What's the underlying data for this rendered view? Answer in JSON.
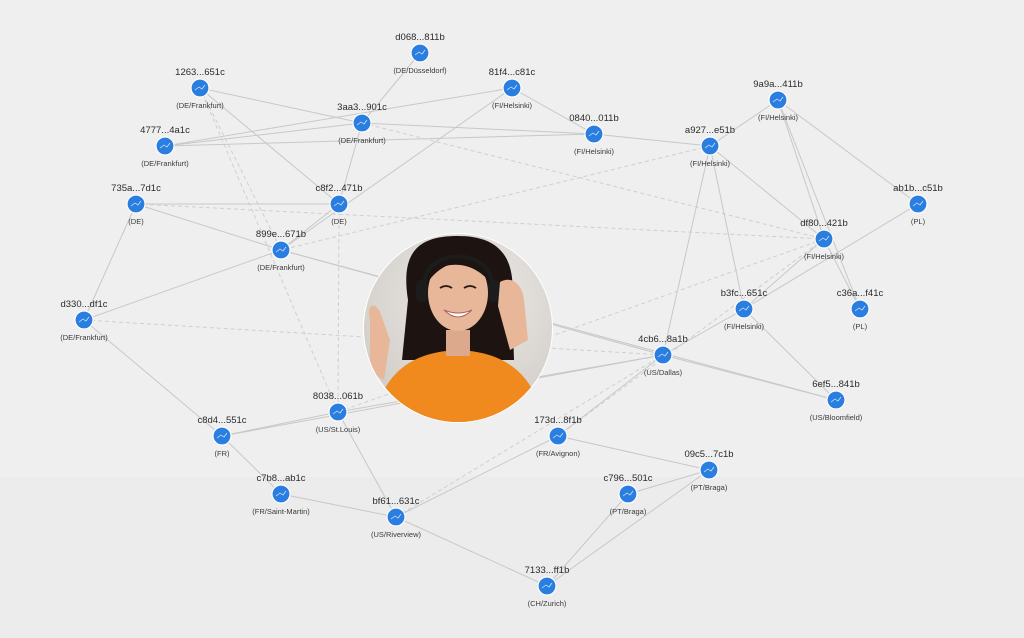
{
  "graph": {
    "nodes": [
      {
        "id": "n1",
        "label": "d068...811b",
        "location": "(DE/Düsseldorf)"
      },
      {
        "id": "n2",
        "label": "1263...651c",
        "location": "(DE/Frankfurt)"
      },
      {
        "id": "n3",
        "label": "81f4...c81c",
        "location": "(FI/Helsinki)"
      },
      {
        "id": "n4",
        "label": "3aa3...901c",
        "location": "(DE/Frankfurt)"
      },
      {
        "id": "n5",
        "label": "0840...011b",
        "location": "(FI/Helsinki)"
      },
      {
        "id": "n6",
        "label": "9a9a...411b",
        "location": "(FI/Helsinki)"
      },
      {
        "id": "n7",
        "label": "4777...4a1c",
        "location": "(DE/Frankfurt)"
      },
      {
        "id": "n8",
        "label": "a927...e51b",
        "location": "(FI/Helsinki)"
      },
      {
        "id": "n9",
        "label": "735a...7d1c",
        "location": "(DE)"
      },
      {
        "id": "n10",
        "label": "c8f2...471b",
        "location": "(DE)"
      },
      {
        "id": "n11",
        "label": "ab1b...c51b",
        "location": "(PL)"
      },
      {
        "id": "n12",
        "label": "899e...671b",
        "location": "(DE/Frankfurt)"
      },
      {
        "id": "n13",
        "label": "df80...421b",
        "location": "(FI/Helsinki)"
      },
      {
        "id": "n14",
        "label": "d330...df1c",
        "location": "(DE/Frankfurt)"
      },
      {
        "id": "n15",
        "label": "b3fc...651c",
        "location": "(FI/Helsinki)"
      },
      {
        "id": "n16",
        "label": "c36a...f41c",
        "location": "(PL)"
      },
      {
        "id": "n17",
        "label": "4cb6...8a1b",
        "location": "(US/Dallas)"
      },
      {
        "id": "n18",
        "label": "6ef5...841b",
        "location": "(US/Bloomfield)"
      },
      {
        "id": "n19",
        "label": "8038...061b",
        "location": "(US/St.Louis)"
      },
      {
        "id": "n20",
        "label": "c8d4...551c",
        "location": "(FR)"
      },
      {
        "id": "n21",
        "label": "173d...8f1b",
        "location": "(FR/Avignon)"
      },
      {
        "id": "n22",
        "label": "09c5...7c1b",
        "location": "(PT/Braga)"
      },
      {
        "id": "n23",
        "label": "c7b8...ab1c",
        "location": "(FR/Saint-Martin)"
      },
      {
        "id": "n24",
        "label": "c796...501c",
        "location": "(PT/Braga)"
      },
      {
        "id": "n25",
        "label": "bf61...631c",
        "location": "(US/Riverview)"
      },
      {
        "id": "n26",
        "label": "7133...ff1b",
        "location": "(CH/Zurich)"
      }
    ],
    "edges": [
      [
        "n2",
        "n4"
      ],
      [
        "n2",
        "n12",
        "dashed"
      ],
      [
        "n2",
        "n10"
      ],
      [
        "n7",
        "n4"
      ],
      [
        "n7",
        "n3"
      ],
      [
        "n7",
        "n5"
      ],
      [
        "n4",
        "n5"
      ],
      [
        "n4",
        "n10"
      ],
      [
        "n4",
        "n13",
        "dashed"
      ],
      [
        "n1",
        "n4"
      ],
      [
        "n3",
        "n5"
      ],
      [
        "n3",
        "n12"
      ],
      [
        "n5",
        "n8"
      ],
      [
        "n6",
        "n8"
      ],
      [
        "n6",
        "n13"
      ],
      [
        "n6",
        "n16"
      ],
      [
        "n6",
        "n11"
      ],
      [
        "n8",
        "n13"
      ],
      [
        "n8",
        "n15"
      ],
      [
        "n8",
        "n17"
      ],
      [
        "n8",
        "n12",
        "dashed"
      ],
      [
        "n9",
        "n10"
      ],
      [
        "n9",
        "n12"
      ],
      [
        "n9",
        "n14"
      ],
      [
        "n9",
        "n13",
        "dashed"
      ],
      [
        "n10",
        "n12"
      ],
      [
        "n10",
        "n19",
        "dashed"
      ],
      [
        "n12",
        "n14"
      ],
      [
        "n12",
        "n17"
      ],
      [
        "n12",
        "n18"
      ],
      [
        "n13",
        "n16"
      ],
      [
        "n13",
        "n15"
      ],
      [
        "n13",
        "n21",
        "dashed"
      ],
      [
        "n11",
        "n15"
      ],
      [
        "n14",
        "n17",
        "dashed"
      ],
      [
        "n14",
        "n20"
      ],
      [
        "n15",
        "n18"
      ],
      [
        "n15",
        "n17"
      ],
      [
        "n17",
        "n21"
      ],
      [
        "n17",
        "n18"
      ],
      [
        "n17",
        "n20"
      ],
      [
        "n17",
        "n25",
        "dashed"
      ],
      [
        "n19",
        "n13",
        "dashed"
      ],
      [
        "n19",
        "n25"
      ],
      [
        "n19",
        "n17"
      ],
      [
        "n20",
        "n23"
      ],
      [
        "n20",
        "n19"
      ],
      [
        "n21",
        "n22"
      ],
      [
        "n21",
        "n25"
      ],
      [
        "n23",
        "n25"
      ],
      [
        "n24",
        "n22"
      ],
      [
        "n24",
        "n26"
      ],
      [
        "n22",
        "n26"
      ],
      [
        "n25",
        "n26"
      ],
      [
        "n19",
        "n2",
        "dashed"
      ]
    ]
  },
  "avatar": {
    "description_name": "support-agent-photo",
    "colors": {
      "skin": "#e8b79a",
      "hair": "#1d1412",
      "shirt": "#f08a1e",
      "headset": "#1c1c1c",
      "bg": "#d8d5d1"
    }
  },
  "colors": {
    "node": "#2a7ee0",
    "edge": "#c8c8c8",
    "background": "#ececec"
  }
}
